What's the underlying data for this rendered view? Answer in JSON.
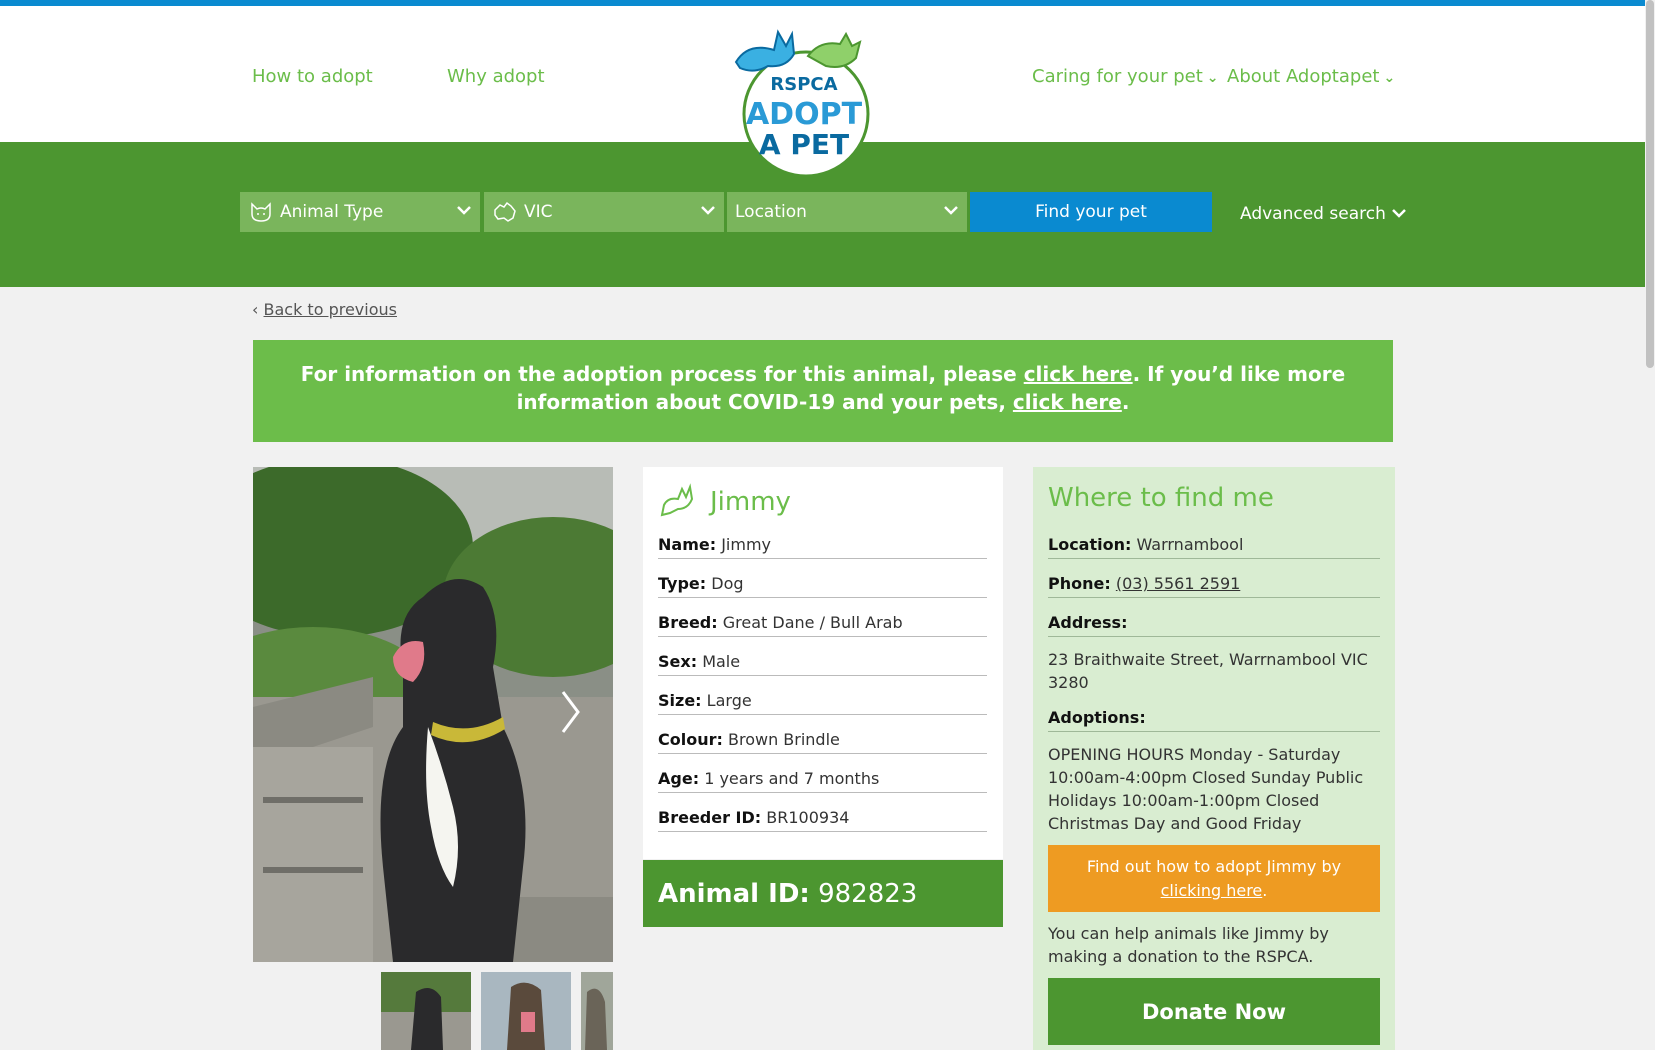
{
  "nav": {
    "how_to_adopt": "How to adopt",
    "why_adopt": "Why adopt",
    "caring": "Caring for your pet",
    "about": "About Adoptapet"
  },
  "logo": {
    "line1": "RSPCA",
    "line2": "ADOPT",
    "line3": "A PET"
  },
  "search": {
    "animal_type": "Animal Type",
    "state": "VIC",
    "location": "Location",
    "find_button": "Find your pet",
    "advanced": "Advanced search"
  },
  "back_link": "Back to previous",
  "banner": {
    "text1": "For information on the adoption process for this animal, please ",
    "link1": "click here",
    "text2": ". If you’d like more information about COVID-19 and your pets, ",
    "link2": "click here",
    "text3": "."
  },
  "pet": {
    "title": "Jimmy",
    "rows": [
      {
        "label": "Name:",
        "value": "Jimmy"
      },
      {
        "label": "Type:",
        "value": "Dog"
      },
      {
        "label": "Breed:",
        "value": "Great Dane / Bull Arab"
      },
      {
        "label": "Sex:",
        "value": "Male"
      },
      {
        "label": "Size:",
        "value": "Large"
      },
      {
        "label": "Colour:",
        "value": "Brown Brindle"
      },
      {
        "label": "Age:",
        "value": "1 years and 7 months"
      },
      {
        "label": "Breeder ID:",
        "value": "BR100934"
      }
    ],
    "animal_id_label": "Animal ID:",
    "animal_id": "982823"
  },
  "findme": {
    "heading": "Where to find me",
    "location_label": "Location:",
    "location": "Warrnambool",
    "phone_label": "Phone:",
    "phone": "(03) 5561 2591",
    "address_label": "Address:",
    "address": "23 Braithwaite Street, Warrnambool VIC 3280",
    "adoptions_label": "Adoptions:",
    "hours": "OPENING HOURS Monday - Saturday 10:00am-4:00pm Closed Sunday Public Holidays 10:00am-1:00pm Closed Christmas Day and Good Friday",
    "adopt_text": "Find out how to adopt Jimmy by ",
    "adopt_link": "clicking here",
    "adopt_end": ".",
    "help_text": "You can help animals like Jimmy by making a donation to the RSPCA.",
    "donate": "Donate Now"
  },
  "colors": {
    "brand_green": "#4c9630",
    "light_green": "#6cbd4a",
    "accent_blue": "#0a8ad0",
    "orange": "#ee9b22"
  }
}
